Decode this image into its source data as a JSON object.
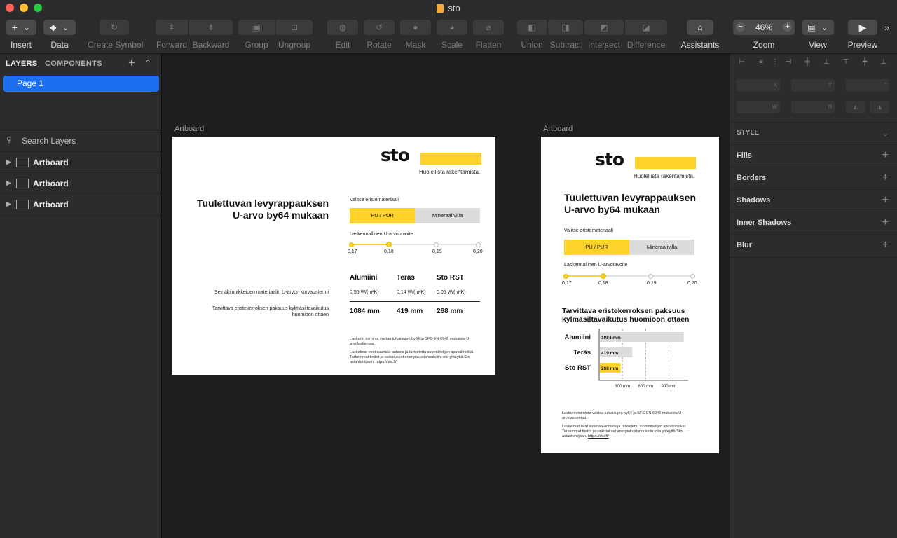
{
  "window": {
    "title": "sto"
  },
  "toolbar": {
    "insert": "Insert",
    "data": "Data",
    "create_symbol": "Create Symbol",
    "forward": "Forward",
    "backward": "Backward",
    "group": "Group",
    "ungroup": "Ungroup",
    "edit": "Edit",
    "rotate": "Rotate",
    "mask": "Mask",
    "scale": "Scale",
    "flatten": "Flatten",
    "union": "Union",
    "subtract": "Subtract",
    "intersect": "Intersect",
    "difference": "Difference",
    "assistants": "Assistants",
    "zoom": "Zoom",
    "zoom_value": "46%",
    "view": "View",
    "preview": "Preview"
  },
  "left_panel": {
    "tab_layers": "LAYERS",
    "tab_components": "COMPONENTS",
    "pages": [
      "Page 1"
    ],
    "search_placeholder": "Search Layers",
    "layers": [
      "Artboard",
      "Artboard",
      "Artboard"
    ]
  },
  "artboards": [
    {
      "label": "Artboard",
      "logo": "sto",
      "tagline": "Huolellista rakentamista.",
      "title_line1": "Tuulettuvan levyrappauksen",
      "title_line2": "U-arvo by64 mukaan",
      "material_label": "Valitse eristemateriaali",
      "material_options": [
        "PU / PUR",
        "Mineraalivilla"
      ],
      "selected_material": "PU / PUR",
      "uvalue_label": "Laskennallinen U-arvotavoite",
      "slider_ticks": [
        "0,17",
        "0,18",
        "0,19",
        "0,20"
      ],
      "slider_value": "0,18",
      "columns": [
        "Alumiini",
        "Teräs",
        "Sto RST"
      ],
      "row1_label": "Seinäkiinnikkeiden materiaalin U-arvon korvaustermi",
      "row1_values": [
        "0,55 W/(m²K)",
        "0,14 W/(m²K)",
        "0,05 W/(m²K)"
      ],
      "row2_label_line1": "Tarvittava eristekerroksen paksuus kylmäsiltavaikutus",
      "row2_label_line2": "huomioon ottaen",
      "row2_values": [
        "1084 mm",
        "419 mm",
        "268 mm"
      ],
      "foot1": "Laskurin toiminta vastaa julkaisujen by64 ja SFS-EN 6946 mukaista U-arvolaskentaa.",
      "foot2": "Laskelmat ovat suuntaa-antavia ja tarkoitettu suunnittelijan apuvälineiksi. Tarkemmat tiedot ja vaikutukset energiakustannuksiin: ota yhteyttä Sto-asiantuntijaan.",
      "link": "https://sto.fi/"
    },
    {
      "label": "Artboard",
      "logo": "sto",
      "tagline": "Huolellista rakentamista.",
      "title_line1": "Tuulettuvan levyrappauksen",
      "title_line2": "U-arvo by64 mukaan",
      "material_label": "Valitse eristemateriaali",
      "material_options": [
        "PU / PUR",
        "Mineraalivilla"
      ],
      "uvalue_label": "Laskennallinen U-arvotavoite",
      "slider_ticks": [
        "0,17",
        "0,18",
        "0,19",
        "0,20"
      ],
      "chart_title_line1": "Tarvittava eristekerroksen paksuus",
      "chart_title_line2": "kylmäsiltavaikutus huomioon ottaen",
      "foot1": "Laskurin toiminta vastaa julkaisujen by64 ja SFS-EN 6946 mukaista U-arvolaskentaa.",
      "foot2": "Laskelmat ovat suuntaa-antavia ja tarkoitettu suunnittelijan apuvälineiksi. Tarkemmat tiedot ja vaikutukset energiakustannuksiin: ota yhteyttä Sto-asiantuntijaan.",
      "link": "https://sto.fi/"
    }
  ],
  "chart_data": {
    "type": "bar",
    "orientation": "horizontal",
    "categories": [
      "Alumiini",
      "Teräs",
      "Sto RST"
    ],
    "values": [
      1084,
      419,
      268
    ],
    "value_labels": [
      "1084 mm",
      "419 mm",
      "268 mm"
    ],
    "x_ticks": [
      "300 mm",
      "600 mm",
      "900 mm"
    ],
    "xlim": [
      0,
      1150
    ],
    "colors": [
      "#dcdcdc",
      "#dcdcdc",
      "#fdd22b"
    ]
  },
  "right_panel": {
    "fields": [
      "X",
      "Y",
      "°",
      "W",
      "H"
    ],
    "style_label": "STYLE",
    "sections": [
      "Fills",
      "Borders",
      "Shadows",
      "Inner Shadows",
      "Blur"
    ]
  },
  "colors": {
    "accent": "#1d6ff2",
    "brand_yellow": "#fdd22b"
  }
}
